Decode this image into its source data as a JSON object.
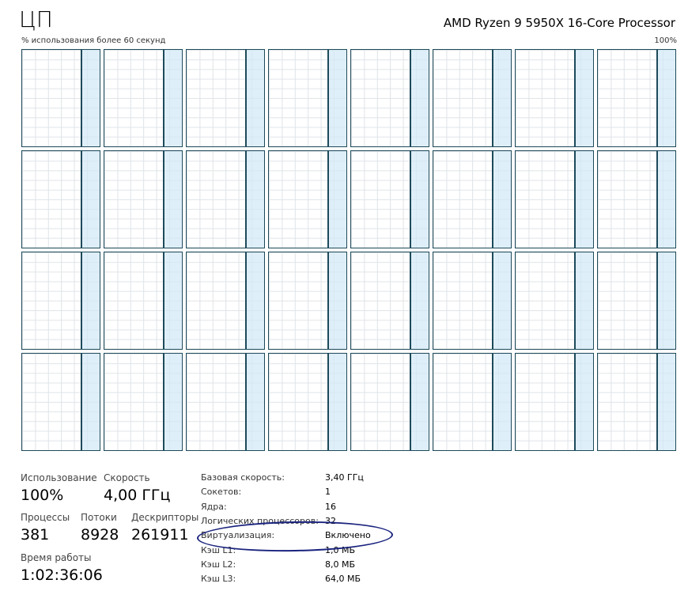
{
  "header": {
    "title": "ЦП",
    "processor": "AMD Ryzen 9 5950X 16-Core Processor",
    "subtitle": "% использования более 60 секунд",
    "max_label": "100%"
  },
  "graphs": {
    "count": 32,
    "columns": 8,
    "usage_percent": 100,
    "recent_fill_fraction": 0.22
  },
  "stats": {
    "usage": {
      "label": "Использование",
      "value": "100%"
    },
    "speed": {
      "label": "Скорость",
      "value": "4,00 ГГц"
    },
    "processes": {
      "label": "Процессы",
      "value": "381"
    },
    "threads": {
      "label": "Потоки",
      "value": "8928"
    },
    "handles": {
      "label": "Дескрипторы",
      "value": "261911"
    },
    "uptime": {
      "label": "Время работы",
      "value": "1:02:36:06"
    }
  },
  "specs": [
    {
      "label": "Базовая скорость:",
      "value": "3,40 ГГц"
    },
    {
      "label": "Сокетов:",
      "value": "1"
    },
    {
      "label": "Ядра:",
      "value": "16"
    },
    {
      "label": "Логических процессоров:",
      "value": "32"
    },
    {
      "label": "Виртуализация:",
      "value": "Включено"
    },
    {
      "label": "Кэш L1:",
      "value": "1,0 МБ"
    },
    {
      "label": "Кэш L2:",
      "value": "8,0 МБ"
    },
    {
      "label": "Кэш L3:",
      "value": "64,0 МБ"
    }
  ],
  "colors": {
    "border": "#1d4a5a",
    "fill": "#d2e8f6",
    "annotation": "#1a237e"
  }
}
